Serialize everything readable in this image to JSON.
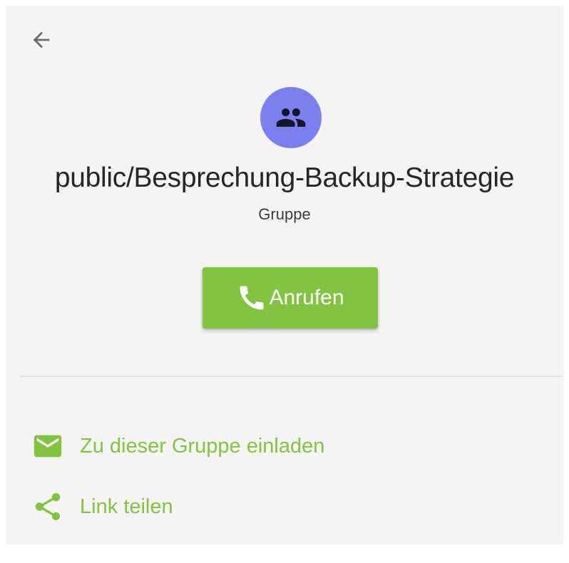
{
  "colors": {
    "accent": "#82c341",
    "avatar_bg": "#7b7ff0",
    "background": "#f4f4f4"
  },
  "header": {
    "back_icon": "arrow-left-icon"
  },
  "conversation": {
    "avatar_icon": "group-icon",
    "name": "public/Besprechung-Backup-Strategie",
    "type": "Gruppe"
  },
  "call_button": {
    "icon": "phone-icon",
    "label": "Anrufen"
  },
  "actions": [
    {
      "icon": "mail-icon",
      "label": "Zu dieser Gruppe einladen"
    },
    {
      "icon": "share-icon",
      "label": "Link teilen"
    }
  ]
}
